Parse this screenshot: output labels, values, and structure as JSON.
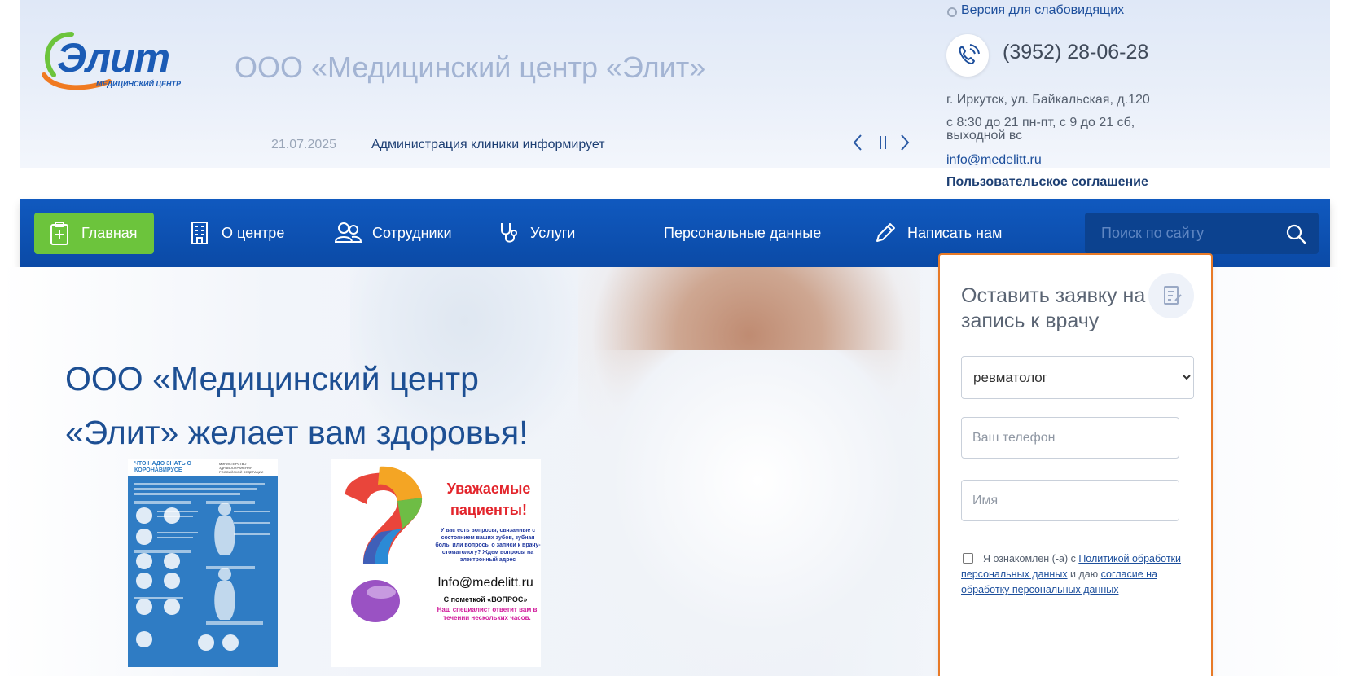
{
  "header": {
    "logo_text": "Элит",
    "logo_subtitle": "медицинский центр",
    "site_title": "ООО «Медицинский центр «Элит»",
    "news": {
      "date": "21.07.2025",
      "text": "Администрация клиники информирует",
      "prev": "‹",
      "pause": "||",
      "next": "›"
    },
    "contacts": {
      "low_vision_link": "Версия для слабовидящих",
      "phone": "(3952) 28-06-28",
      "address": "г. Иркутск, ул. Байкальская, д.120",
      "hours": "с 8:30 до 21 пн-пт, с 9 до 21 сб, выходной вс",
      "email": "info@medelitt.ru",
      "agreement": "Пользовательское соглашение"
    }
  },
  "nav": {
    "items": [
      {
        "label": "Главная",
        "icon": "clipboard-plus-icon",
        "active": true
      },
      {
        "label": "О центре",
        "icon": "building-icon",
        "active": false
      },
      {
        "label": "Сотрудники",
        "icon": "staff-icon",
        "active": false
      },
      {
        "label": "Услуги",
        "icon": "stethoscope-icon",
        "active": false
      },
      {
        "label": "Персональные данные",
        "icon": "",
        "active": false
      },
      {
        "label": "Написать нам",
        "icon": "pencil-icon",
        "active": false
      }
    ],
    "search_placeholder": "Поиск по сайту"
  },
  "hero": {
    "title_line1": "ООО «Медицинский центр",
    "title_line2": "«Элит» желает вам здоровья!"
  },
  "poster_covid": {
    "title": "ЧТО НАДО ЗНАТЬ О КОРОНАВИРУСЕ",
    "ministry": "МИНИСТЕРСТВО ЗДРАВООХРАНЕНИЯ РОССИЙСКОЙ ФЕДЕРАЦИИ"
  },
  "poster_dental": {
    "title": "Уважаемые пациенты!",
    "body": "У вас есть вопросы, связанные с состоянием ваших зубов, зубная боль, или вопросы о записи к врачу-стоматологу? Ждем вопросы на электронный адрес",
    "email": "Info@medelitt.ru",
    "mark": "С пометкой «ВОПРОС»",
    "note": "Наш специалист ответит вам в течении нескольких часов."
  },
  "form": {
    "title": "Оставить заявку на запись к врачу",
    "specialty_selected": "ревматолог",
    "phone_placeholder": "Ваш телефон",
    "name_placeholder": "Имя",
    "consent_prefix": "Я ознакомлен (-а) с ",
    "consent_link1": "Политикой обработки персональных данных",
    "consent_middle": " и даю ",
    "consent_link2": "согласие на обработку персональных данных"
  },
  "colors": {
    "nav_bg": "#0b4aa6",
    "active_nav": "#6cc43c",
    "form_border": "#e87a27",
    "hero_title": "#1d4f93"
  }
}
